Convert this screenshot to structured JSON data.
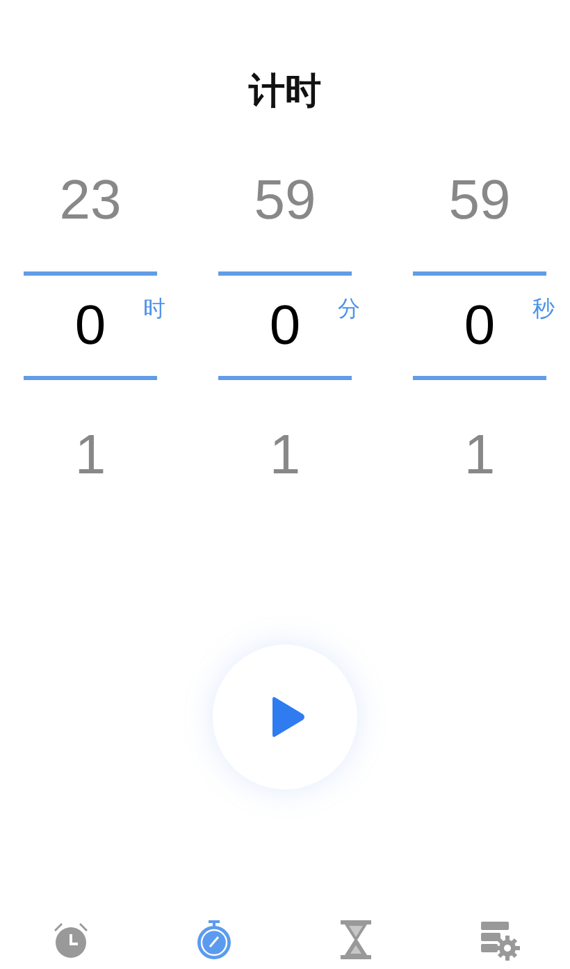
{
  "title": "计时",
  "pickers": [
    {
      "previous": "23",
      "value": "0",
      "next": "1",
      "unit": "时"
    },
    {
      "previous": "59",
      "value": "0",
      "next": "1",
      "unit": "分"
    },
    {
      "previous": "59",
      "value": "0",
      "next": "1",
      "unit": "秒"
    }
  ],
  "tabs": [
    {
      "kind": "alarm",
      "selected": false
    },
    {
      "kind": "stopwatch",
      "selected": true
    },
    {
      "kind": "hourglass",
      "selected": false
    },
    {
      "kind": "settings",
      "selected": false
    }
  ]
}
